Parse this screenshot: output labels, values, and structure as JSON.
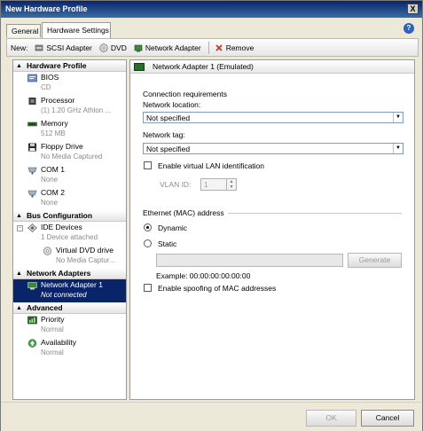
{
  "window": {
    "title": "New Hardware Profile",
    "close_glyph": "X",
    "help_glyph": "?"
  },
  "tabs": [
    {
      "label": "General",
      "active": false
    },
    {
      "label": "Hardware Settings",
      "active": true
    }
  ],
  "toolbar": {
    "new_label": "New:",
    "scsi_label": "SCSI Adapter",
    "dvd_label": "DVD",
    "network_label": "Network Adapter",
    "remove_label": "Remove"
  },
  "sidebar": {
    "hardware_profile": {
      "header": "Hardware Profile",
      "items": [
        {
          "label": "BIOS",
          "sub": "CD",
          "icon": "bios-icon"
        },
        {
          "label": "Processor",
          "sub": "(1) 1.20 GHz Athlon ...",
          "icon": "processor-icon"
        },
        {
          "label": "Memory",
          "sub": "512 MB",
          "icon": "memory-icon"
        },
        {
          "label": "Floppy Drive",
          "sub": "No Media Captured",
          "icon": "floppy-icon"
        },
        {
          "label": "COM 1",
          "sub": "None",
          "icon": "com-port-icon"
        },
        {
          "label": "COM 2",
          "sub": "None",
          "icon": "com-port-icon"
        }
      ]
    },
    "bus_configuration": {
      "header": "Bus Configuration",
      "items": [
        {
          "label": "IDE Devices",
          "sub": "1 Device attached",
          "icon": "ide-icon"
        },
        {
          "label": "Virtual DVD drive",
          "sub": "No Media Captur...",
          "icon": "dvd-icon"
        }
      ]
    },
    "network_adapters": {
      "header": "Network Adapters",
      "items": [
        {
          "label": "Network Adapter 1",
          "sub": "Not connected",
          "icon": "network-adapter-icon",
          "selected": true
        }
      ]
    },
    "advanced": {
      "header": "Advanced",
      "items": [
        {
          "label": "Priority",
          "sub": "Normal",
          "icon": "priority-icon"
        },
        {
          "label": "Availability",
          "sub": "Normal",
          "icon": "availability-icon"
        }
      ]
    }
  },
  "detail": {
    "header": "Network Adapter 1 (Emulated)",
    "connection_requirements": "Connection requirements",
    "network_location_label": "Network location:",
    "network_location_value": "Not specified",
    "network_tag_label": "Network tag:",
    "network_tag_value": "Not specified",
    "enable_vlan_label": "Enable virtual LAN identification",
    "vlan_id_label": "VLAN ID:",
    "vlan_id_value": "1",
    "mac_section_label": "Ethernet (MAC) address",
    "dynamic_label": "Dynamic",
    "static_label": "Static",
    "mac_value": "",
    "generate_label": "Generate",
    "example_text": "Example: 00:00:00:00:00:00",
    "spoofing_label": "Enable spoofing of MAC addresses"
  },
  "footer": {
    "ok_label": "OK",
    "cancel_label": "Cancel"
  }
}
